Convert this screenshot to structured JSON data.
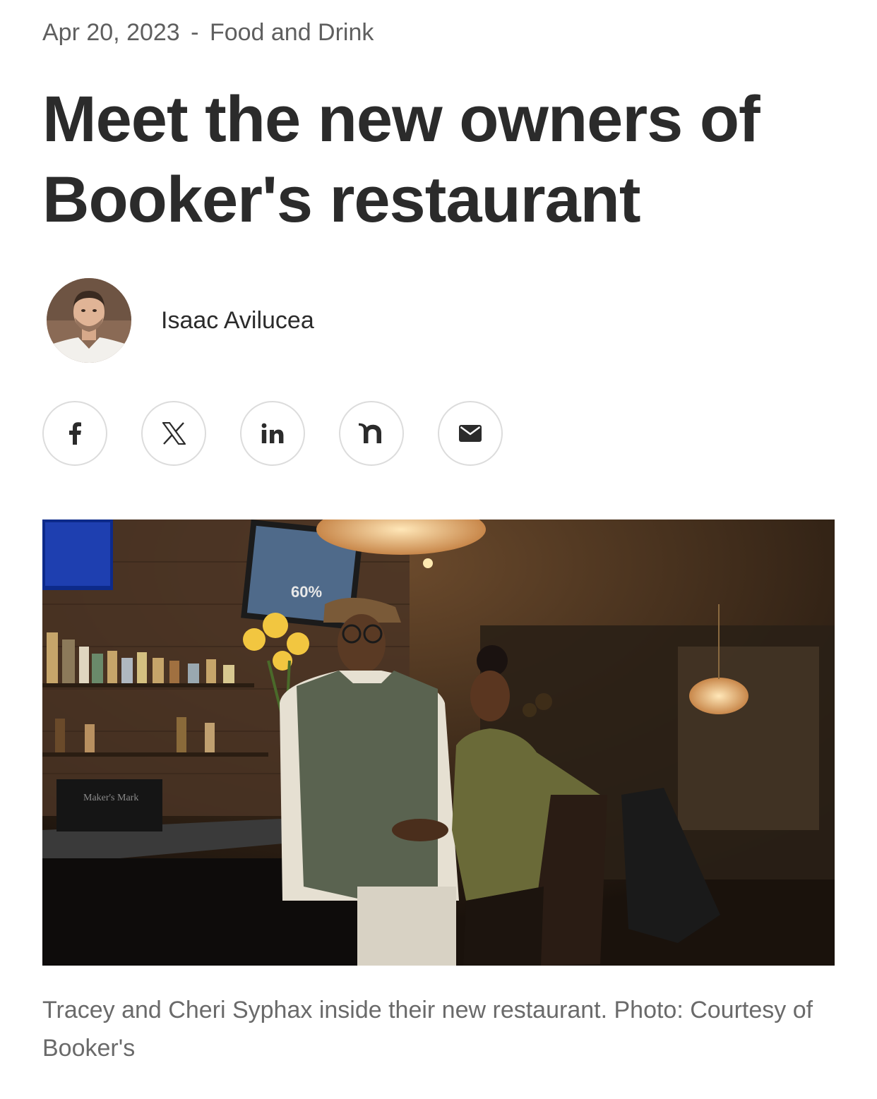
{
  "meta": {
    "date": "Apr 20, 2023",
    "separator": "-",
    "category": "Food and Drink"
  },
  "article": {
    "title": "Meet the new owners of Booker's restaurant",
    "author": "Isaac Avilucea",
    "caption": "Tracey and Cheri Syphax inside their new restaurant. Photo: Courtesy of Booker's"
  },
  "share": {
    "icons": [
      "facebook-icon",
      "x-icon",
      "linkedin-icon",
      "nextdoor-icon",
      "email-icon"
    ]
  },
  "photo": {
    "tv_text": "60%",
    "box_text": "Maker's Mark"
  },
  "colors": {
    "text": "#2b2b2b",
    "muted": "#6a6a6a",
    "border": "#dcdcdc"
  }
}
